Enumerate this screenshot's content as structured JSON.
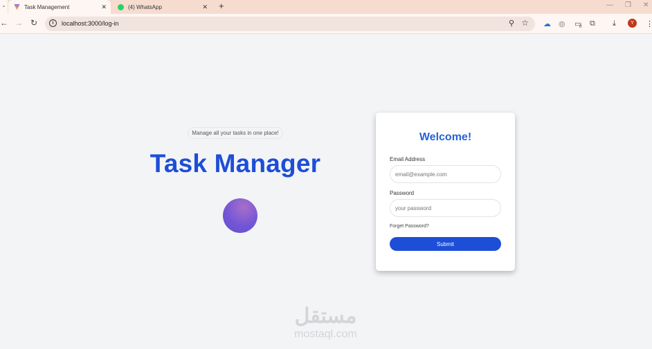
{
  "browser": {
    "tabs": [
      {
        "label": "Task Management",
        "close": "✕"
      },
      {
        "label": "(4) WhatsApp",
        "close": "✕"
      }
    ],
    "new_tab": "+",
    "url": "localhost:3000/log-in",
    "profile_initial": "Y",
    "download_badge": "0"
  },
  "hero": {
    "tagline": "Manage all your tasks in one place!",
    "title": "Task Manager"
  },
  "login": {
    "heading": "Welcome!",
    "email_label": "Email Address",
    "email_placeholder": "email@example.com",
    "password_label": "Password",
    "password_placeholder": "your password",
    "forgot": "Forget Password?",
    "submit": "Submit"
  },
  "watermark": {
    "arabic": "مستقل",
    "latin": "mostaql.com"
  }
}
